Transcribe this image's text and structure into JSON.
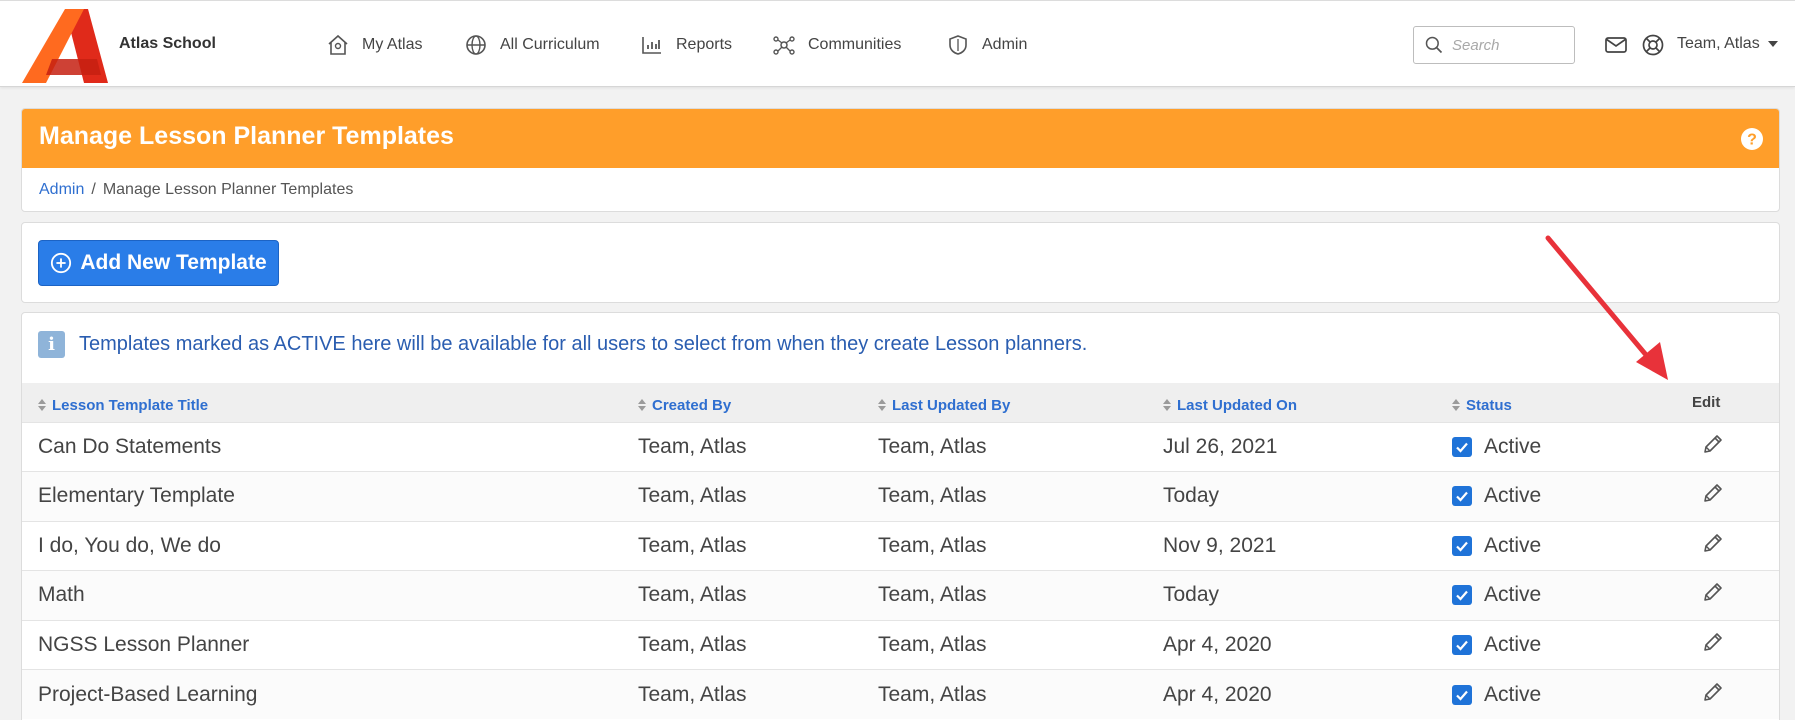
{
  "app": {
    "school_name": "Atlas School",
    "brand_colors": {
      "logo_orange": "#ff6a1f",
      "logo_red": "#e02a1a",
      "header_orange": "#ff9e2a",
      "primary_blue": "#2a7de8",
      "link_blue": "#2f6fd0"
    }
  },
  "nav": {
    "items": [
      {
        "label": "My Atlas",
        "icon": "home-icon"
      },
      {
        "label": "All Curriculum",
        "icon": "globe-icon"
      },
      {
        "label": "Reports",
        "icon": "bar-chart-icon"
      },
      {
        "label": "Communities",
        "icon": "network-icon"
      },
      {
        "label": "Admin",
        "icon": "shield-icon"
      }
    ],
    "search_placeholder": "Search",
    "user_name": "Team, Atlas"
  },
  "page": {
    "title": "Manage Lesson Planner Templates",
    "breadcrumb": [
      {
        "label": "Admin"
      },
      {
        "label": "Manage Lesson Planner Templates"
      }
    ],
    "add_button_label": "Add New Template",
    "info_text": "Templates marked as ACTIVE here will be available for all users to select from when they create Lesson planners."
  },
  "table": {
    "columns": [
      "Lesson Template Title",
      "Created By",
      "Last Updated By",
      "Last Updated On",
      "Status",
      "Edit"
    ],
    "rows": [
      {
        "title": "Can Do Statements",
        "created_by": "Team, Atlas",
        "updated_by": "Team, Atlas",
        "updated_on": "Jul 26, 2021",
        "status": "Active",
        "checked": true
      },
      {
        "title": "Elementary Template",
        "created_by": "Team, Atlas",
        "updated_by": "Team, Atlas",
        "updated_on": "Today",
        "status": "Active",
        "checked": true
      },
      {
        "title": "I do, You do, We do",
        "created_by": "Team, Atlas",
        "updated_by": "Team, Atlas",
        "updated_on": "Nov 9, 2021",
        "status": "Active",
        "checked": true
      },
      {
        "title": "Math",
        "created_by": "Team, Atlas",
        "updated_by": "Team, Atlas",
        "updated_on": "Today",
        "status": "Active",
        "checked": true
      },
      {
        "title": "NGSS Lesson Planner",
        "created_by": "Team, Atlas",
        "updated_by": "Team, Atlas",
        "updated_on": "Apr 4, 2020",
        "status": "Active",
        "checked": true
      },
      {
        "title": "Project-Based Learning",
        "created_by": "Team, Atlas",
        "updated_by": "Team, Atlas",
        "updated_on": "Apr 4, 2020",
        "status": "Active",
        "checked": true
      }
    ]
  }
}
